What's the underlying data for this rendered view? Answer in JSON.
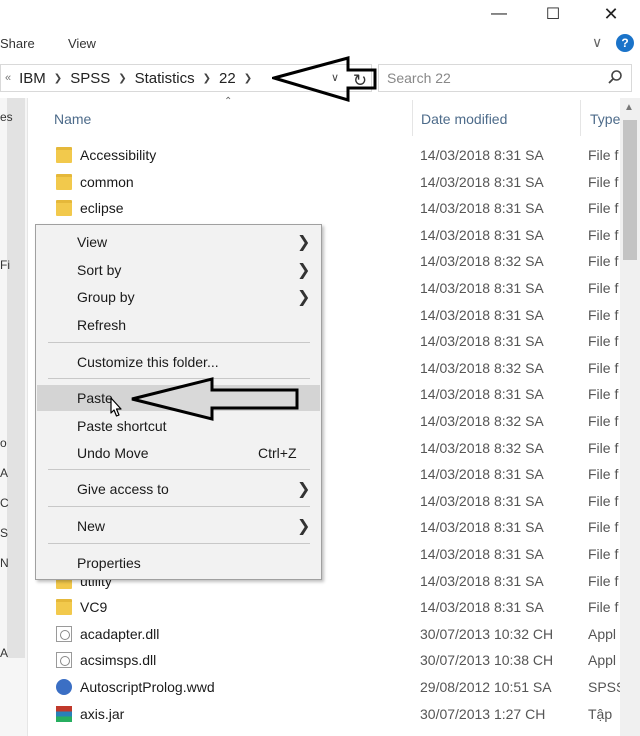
{
  "ribbon": {
    "tabs": [
      "Share",
      "View"
    ]
  },
  "window": {
    "minimize_glyph": "—",
    "maximize_glyph": "☐",
    "close_glyph": "✕"
  },
  "address": {
    "lead": "«",
    "crumbs": [
      "IBM",
      "SPSS",
      "Statistics",
      "22"
    ],
    "search_placeholder": "Search 22"
  },
  "columns": {
    "name": "Name",
    "date": "Date modified",
    "type": "Type"
  },
  "files": [
    {
      "name": "Accessibility",
      "date": "14/03/2018 8:31 SA",
      "type": "File f",
      "icon": "folder-icon"
    },
    {
      "name": "common",
      "date": "14/03/2018 8:31 SA",
      "type": "File f",
      "icon": "folder-icon"
    },
    {
      "name": "eclipse",
      "date": "14/03/2018 8:31 SA",
      "type": "File f",
      "icon": "folder-icon"
    },
    {
      "name": "",
      "date": "14/03/2018 8:31 SA",
      "type": "File f",
      "icon": "folder-icon"
    },
    {
      "name": "",
      "date": "14/03/2018 8:32 SA",
      "type": "File f",
      "icon": "folder-icon"
    },
    {
      "name": "",
      "date": "14/03/2018 8:31 SA",
      "type": "File f",
      "icon": "folder-icon"
    },
    {
      "name": "",
      "date": "14/03/2018 8:31 SA",
      "type": "File f",
      "icon": "folder-icon"
    },
    {
      "name": "",
      "date": "14/03/2018 8:31 SA",
      "type": "File f",
      "icon": "folder-icon"
    },
    {
      "name": "",
      "date": "14/03/2018 8:32 SA",
      "type": "File f",
      "icon": "folder-icon"
    },
    {
      "name": "",
      "date": "14/03/2018 8:31 SA",
      "type": "File f",
      "icon": "folder-icon"
    },
    {
      "name": "",
      "date": "14/03/2018 8:32 SA",
      "type": "File f",
      "icon": "folder-icon"
    },
    {
      "name": "",
      "date": "14/03/2018 8:32 SA",
      "type": "File f",
      "icon": "folder-icon"
    },
    {
      "name": "",
      "date": "14/03/2018 8:31 SA",
      "type": "File f",
      "icon": "folder-icon"
    },
    {
      "name": "",
      "date": "14/03/2018 8:31 SA",
      "type": "File f",
      "icon": "folder-icon"
    },
    {
      "name": "",
      "date": "14/03/2018 8:31 SA",
      "type": "File f",
      "icon": "folder-icon"
    },
    {
      "name": "",
      "date": "14/03/2018 8:31 SA",
      "type": "File f",
      "icon": "folder-icon"
    },
    {
      "name": "utility",
      "date": "14/03/2018 8:31 SA",
      "type": "File f",
      "icon": "folder-icon"
    },
    {
      "name": "VC9",
      "date": "14/03/2018 8:31 SA",
      "type": "File f",
      "icon": "folder-icon"
    },
    {
      "name": "acadapter.dll",
      "date": "30/07/2013 10:32 CH",
      "type": "Appl",
      "icon": "dll-icon"
    },
    {
      "name": "acsimsps.dll",
      "date": "30/07/2013 10:38 CH",
      "type": "Appl",
      "icon": "dll-icon"
    },
    {
      "name": "AutoscriptProlog.wwd",
      "date": "29/08/2012 10:51 SA",
      "type": "SPSS",
      "icon": "wwd-icon"
    },
    {
      "name": "axis.jar",
      "date": "30/07/2013 1:27 CH",
      "type": "Tập",
      "icon": "jar-icon"
    }
  ],
  "context_menu": {
    "items": [
      {
        "label": "View",
        "submenu": true
      },
      {
        "label": "Sort by",
        "submenu": true
      },
      {
        "label": "Group by",
        "submenu": true
      },
      {
        "label": "Refresh"
      },
      {
        "separator": true
      },
      {
        "label": "Customize this folder..."
      },
      {
        "separator": true
      },
      {
        "label": "Paste",
        "hover": true
      },
      {
        "label": "Paste shortcut"
      },
      {
        "label": "Undo Move",
        "shortcut": "Ctrl+Z"
      },
      {
        "separator": true
      },
      {
        "label": "Give access to",
        "submenu": true
      },
      {
        "separator": true
      },
      {
        "label": "New",
        "submenu": true
      },
      {
        "separator": true
      },
      {
        "label": "Properties"
      }
    ]
  },
  "nav_sliver": [
    "es",
    "Fi",
    "o",
    "A",
    "C",
    "S",
    "N",
    "A"
  ],
  "colors": {
    "accent": "#1a73c9",
    "header_text": "#4d6b8a",
    "menu_bg": "#f2f2f2",
    "menu_hover": "#d4d4d4",
    "folder": "#f2c94c"
  }
}
